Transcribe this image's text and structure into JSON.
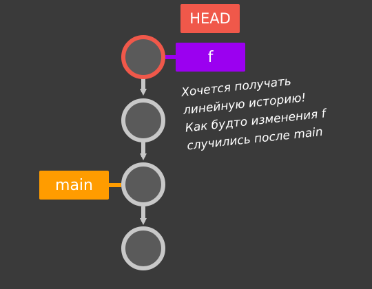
{
  "labels": {
    "head": "HEAD",
    "branch_f": "f",
    "branch_main": "main"
  },
  "annotation": {
    "lines": [
      "Хочется получать",
      "линейную историю!",
      "Как будто изменения f",
      "случились после main"
    ]
  },
  "colors": {
    "background": "#3a3a3a",
    "head": "#f0584a",
    "branch_f": "#9b00f0",
    "branch_main": "#ff9c00",
    "commit_ring": "#c8c8c8",
    "commit_fill": "#5a5a5a",
    "current_ring": "#f0584a",
    "arrow": "#c8c8c8"
  },
  "commits": [
    {
      "name": "commit-f",
      "is_head": true
    },
    {
      "name": "commit-2",
      "is_head": false
    },
    {
      "name": "commit-main",
      "is_head": false
    },
    {
      "name": "commit-base",
      "is_head": false
    }
  ]
}
